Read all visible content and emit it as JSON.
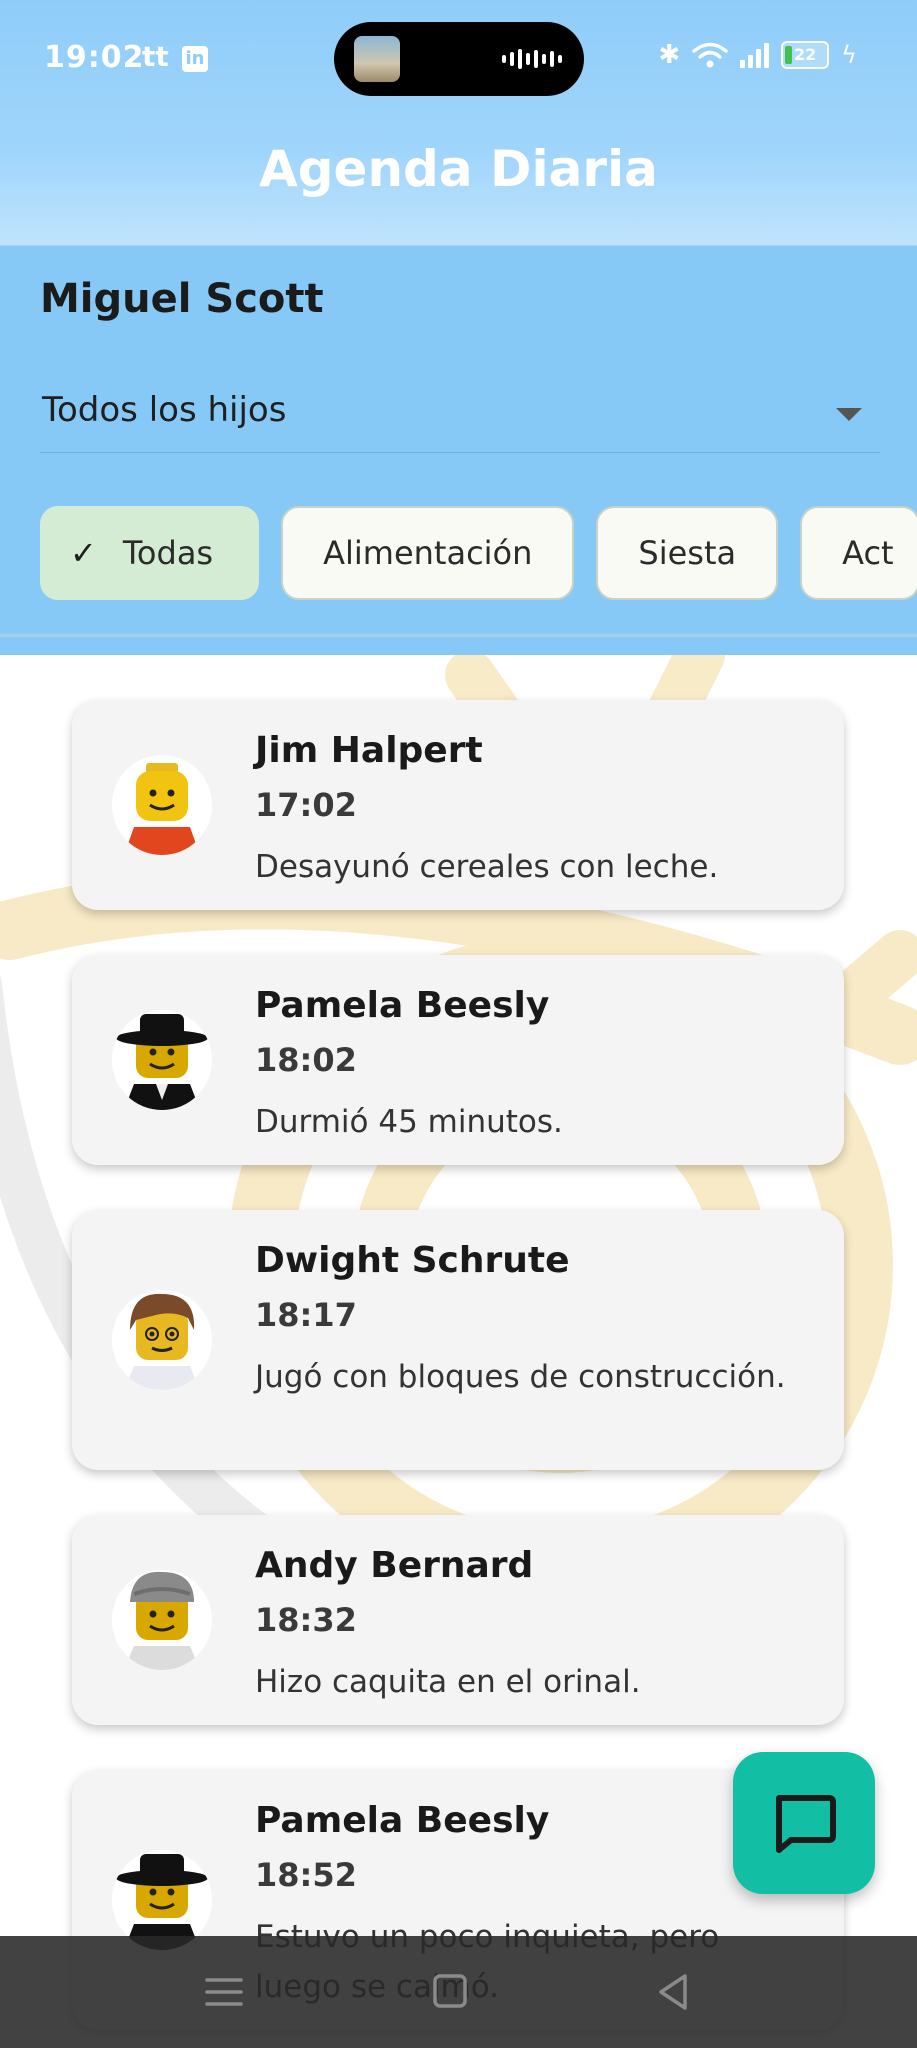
{
  "status_bar": {
    "time": "19:02",
    "app_icon_text": "tt",
    "linkedin_icon_text": "in",
    "battery_level": "22"
  },
  "app_bar": {
    "title": "Agenda Diaria"
  },
  "filters": {
    "teacher_name": "Miguel Scott",
    "child_select": {
      "value": "Todos los hijos"
    },
    "chips": [
      {
        "label": "Todas",
        "selected": true
      },
      {
        "label": "Alimentación",
        "selected": false
      },
      {
        "label": "Siesta",
        "selected": false
      },
      {
        "label": "Act",
        "selected": false
      }
    ]
  },
  "entries": [
    {
      "name": "Jim Halpert",
      "time": "17:02",
      "text": "Desayunó cereales con leche.",
      "avatar": "lego-figure-red-shirt"
    },
    {
      "name": "Pamela Beesly",
      "time": "18:02",
      "text": "Durmió 45 minutos.",
      "avatar": "lego-figure-black-hat"
    },
    {
      "name": "Dwight Schrute",
      "time": "18:17",
      "text": "Jugó con bloques de construcción.",
      "avatar": "lego-figure-brown-hair-glasses"
    },
    {
      "name": "Andy Bernard",
      "time": "18:32",
      "text": "Hizo caquita en el orinal.",
      "avatar": "lego-figure-grey-cap"
    },
    {
      "name": "Pamela Beesly",
      "time": "18:52",
      "text": "Estuvo un poco inquieta, pero luego se calmó.",
      "avatar": "lego-figure-black-hat"
    }
  ],
  "fab": {
    "icon": "chat-bubble-icon"
  },
  "colors": {
    "header": "#86c9f6",
    "fab": "#12bfa4",
    "chip_selected": "#d4ebd4",
    "card": "#f4f4f4"
  }
}
